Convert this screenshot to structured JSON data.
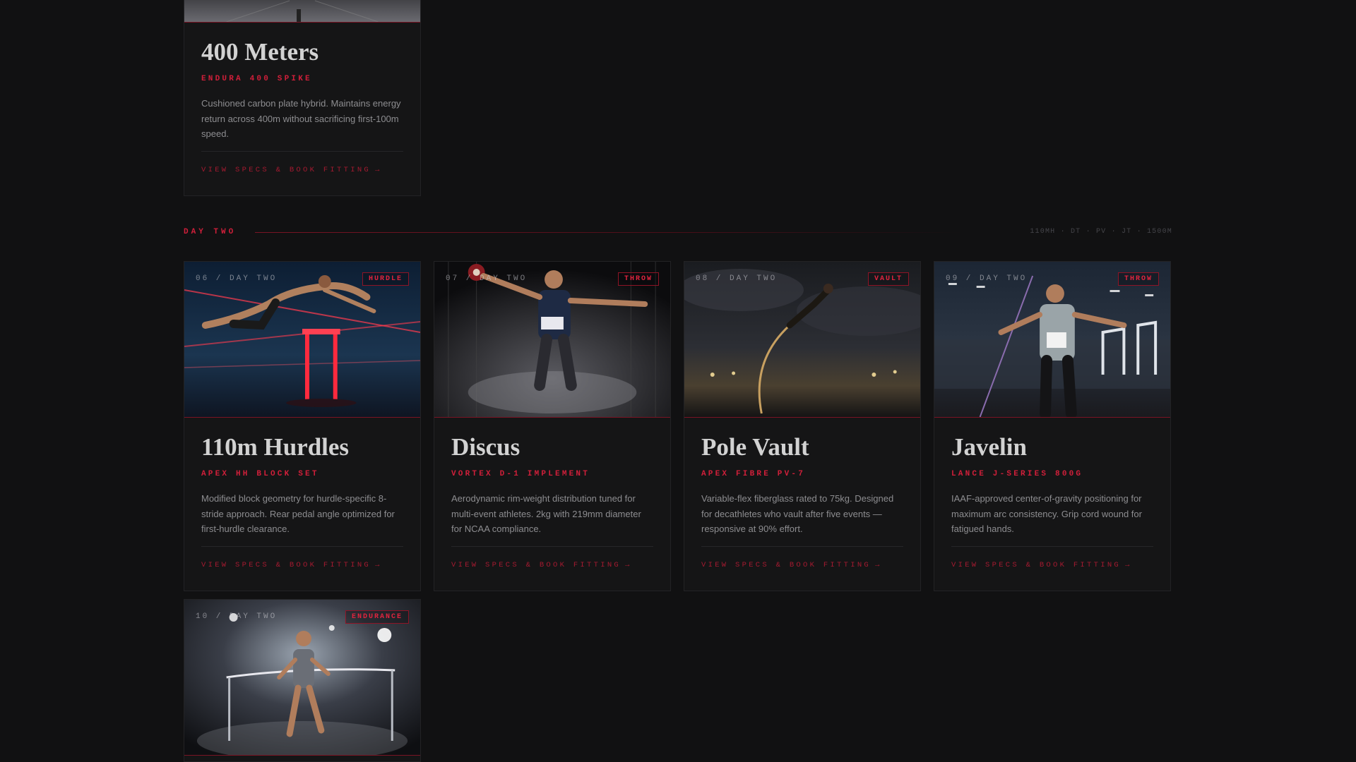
{
  "colors": {
    "background": "#111112",
    "card": "#151516",
    "accent": "#d11f3a",
    "muted": "#8d8d90"
  },
  "top_card": {
    "title": "400 Meters",
    "model": "ENDURA 400 SPIKE",
    "description": "Cushioned carbon plate hybrid. Maintains energy return across 400m without sacrificing first-100m speed.",
    "link": "VIEW SPECS & BOOK FITTING",
    "arrow": "→"
  },
  "day_two": {
    "label": "DAY TWO",
    "events": "110MH · DT · PV · JT · 1500M"
  },
  "cards": [
    {
      "index": "06 / DAY TWO",
      "tag": "HURDLE",
      "title": "110m Hurdles",
      "model": "APEX HH BLOCK SET",
      "description": "Modified block geometry for hurdle-specific 8-stride approach. Rear pedal angle optimized for first-hurdle clearance.",
      "link": "VIEW SPECS & BOOK FITTING",
      "arrow": "→",
      "image": "hurdler-photo"
    },
    {
      "index": "07 / DAY TWO",
      "tag": "THROW",
      "title": "Discus",
      "model": "VORTEX D-1 IMPLEMENT",
      "description": "Aerodynamic rim-weight distribution tuned for multi-event athletes. 2kg with 219mm diameter for NCAA compliance.",
      "link": "VIEW SPECS & BOOK FITTING",
      "arrow": "→",
      "image": "discus-thrower-photo"
    },
    {
      "index": "08 / DAY TWO",
      "tag": "VAULT",
      "title": "Pole Vault",
      "model": "APEX FIBRE PV-7",
      "description": "Variable-flex fiberglass rated to 75kg. Designed for decathletes who vault after five events — responsive at 90% effort.",
      "link": "VIEW SPECS & BOOK FITTING",
      "arrow": "→",
      "image": "pole-vaulter-photo"
    },
    {
      "index": "09 / DAY TWO",
      "tag": "THROW",
      "title": "Javelin",
      "model": "LANCE J-SERIES 800G",
      "description": "IAAF-approved center-of-gravity positioning for maximum arc consistency. Grip cord wound for fatigued hands.",
      "link": "VIEW SPECS & BOOK FITTING",
      "arrow": "→",
      "image": "javelin-thrower-photo"
    },
    {
      "index": "10 / DAY TWO",
      "tag": "ENDURANCE",
      "image": "runner-finish-photo"
    }
  ]
}
